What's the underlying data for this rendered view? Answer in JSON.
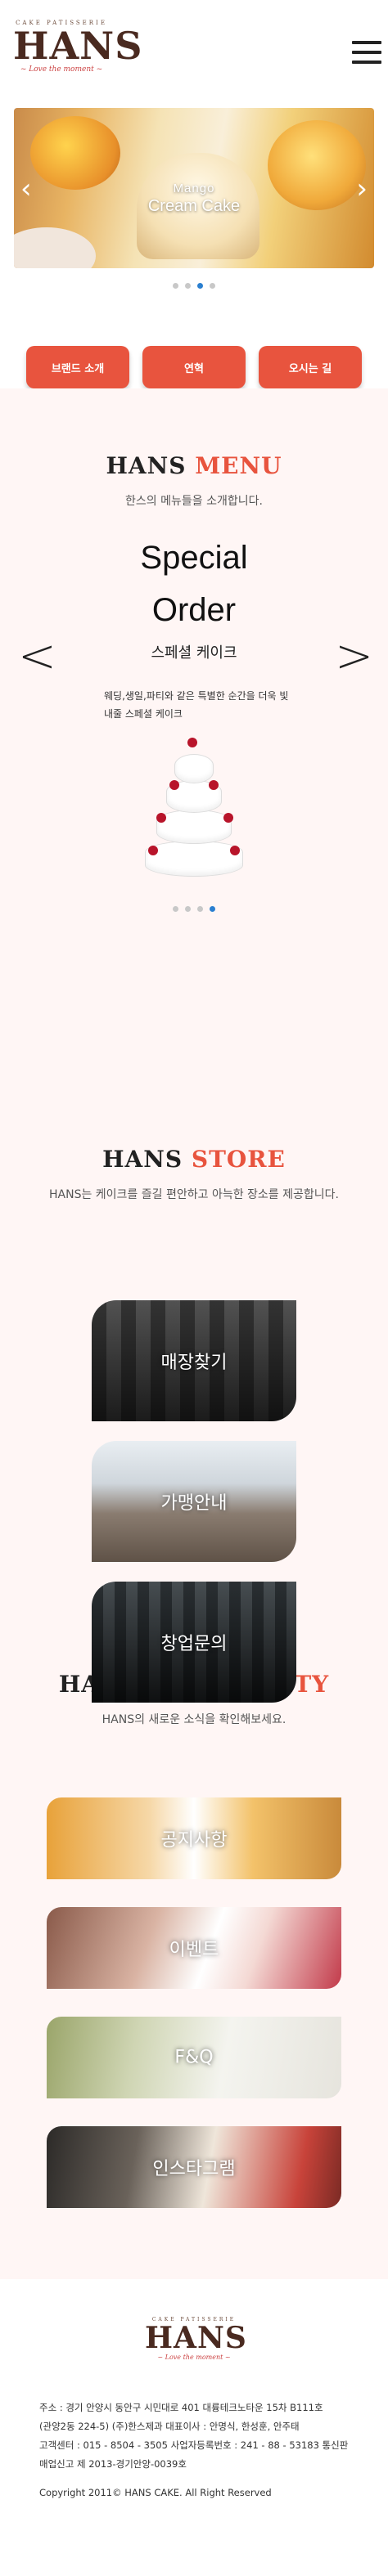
{
  "header": {
    "logo_small": "CAKE PATISSERIE",
    "logo_main": "HANS",
    "logo_tagline": "Love the moment"
  },
  "hero": {
    "line1": "Mango",
    "line2": "Cream Cake",
    "dots": 4,
    "active_dot": 2
  },
  "nav_buttons": [
    {
      "label": "브랜드 소개"
    },
    {
      "label": "연혁"
    },
    {
      "label": "오시는 길"
    }
  ],
  "menu": {
    "title_main": "HANS",
    "title_accent": "MENU",
    "subtitle": "한스의 메뉴들을 소개합니다.",
    "item_title_line1": "Special",
    "item_title_line2": "Order",
    "item_title_kr": "스페셜 케이크",
    "item_desc": "웨딩,생일,파티와 같은 특별한 순간을 더욱 빛내줄 스페셜 케이크",
    "dots": 4,
    "active_dot": 3,
    "arrow_left": "<",
    "arrow_right": ">"
  },
  "store": {
    "title_main": "HANS",
    "title_accent": "STORE",
    "subtitle": "HANS는 케이크를 즐길 편안하고 아늑한 장소를 제공합니다.",
    "cards": [
      {
        "label": "매장찾기"
      },
      {
        "label": "가맹안내"
      },
      {
        "label": "창업문의"
      }
    ]
  },
  "community": {
    "title_main": "HANS",
    "title_accent": "COMMUNITY",
    "subtitle": "HANS의 새로운 소식을 확인해보세요.",
    "cards": [
      {
        "label": "공지사항"
      },
      {
        "label": "이벤트"
      },
      {
        "label": "F&Q"
      },
      {
        "label": "인스타그램"
      }
    ]
  },
  "footer": {
    "logo_small": "CAKE PATISSERIE",
    "logo_main": "HANS",
    "logo_tagline": "Love the moment",
    "address": "주소 : 경기 안양시 동안구 시민대로 401 대륭테크노타운 15차 B111호",
    "address2": "(관양2동 224-5) (주)한스제과 대표이사 : 안명식, 한성훈, 안주태",
    "contact": "고객센터 : 015 - 8504 - 3505 사업자등록번호 : 241 - 88 - 53183 통신판",
    "license": "매업신고 제 2013-경기안양-0039호",
    "copyright": "Copyright 2011© HANS CAKE. All Right Reserved"
  },
  "colors": {
    "accent": "#e8543e",
    "section_bg": "#fff6f5",
    "dot_active": "#2a7fd0",
    "dot_inactive": "#c8c8c8"
  }
}
